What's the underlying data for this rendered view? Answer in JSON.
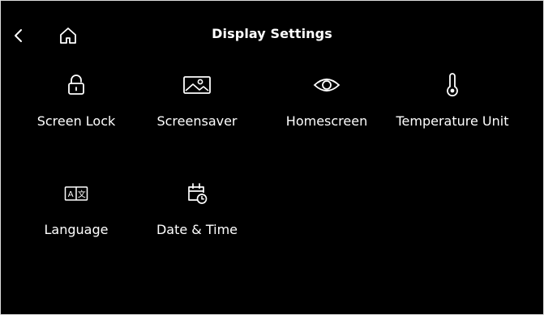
{
  "header": {
    "title": "Display Settings",
    "back_icon": "chevron-left-icon",
    "home_icon": "home-icon"
  },
  "tiles": [
    {
      "label": "Screen Lock",
      "icon": "lock-icon"
    },
    {
      "label": "Screensaver",
      "icon": "image-icon"
    },
    {
      "label": "Homescreen",
      "icon": "eye-icon"
    },
    {
      "label": "Temperature Unit",
      "icon": "thermometer-icon"
    },
    {
      "label": "Language",
      "icon": "translate-icon"
    },
    {
      "label": "Date & Time",
      "icon": "calendar-clock-icon"
    }
  ],
  "colors": {
    "background": "#000000",
    "foreground": "#ffffff"
  }
}
